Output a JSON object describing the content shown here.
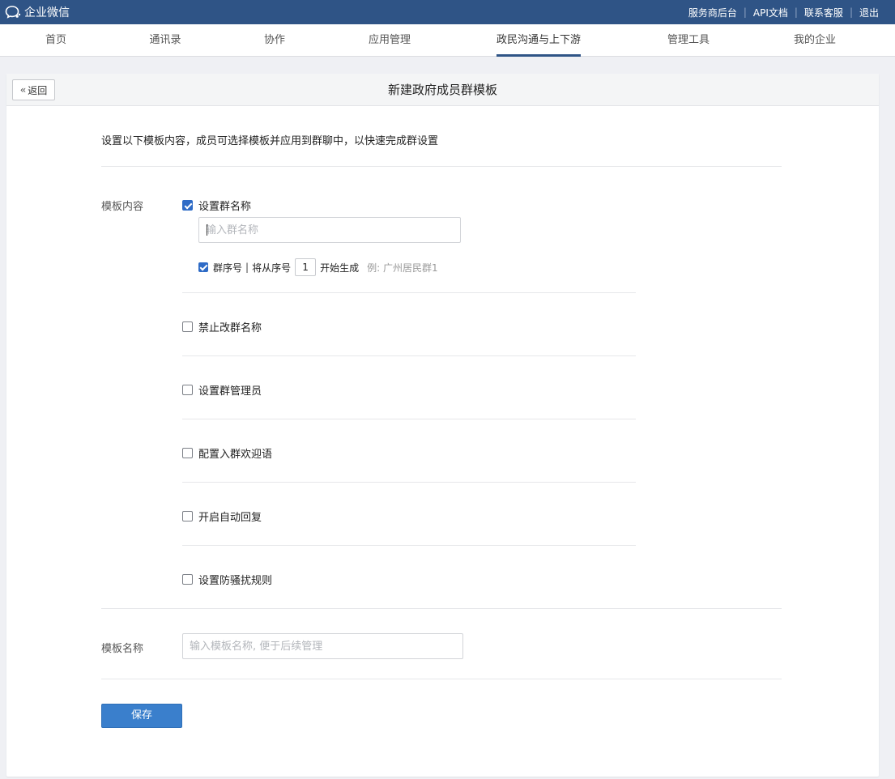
{
  "app": {
    "name": "企业微信"
  },
  "toplinks": [
    "服务商后台",
    "API文档",
    "联系客服",
    "退出"
  ],
  "nav": {
    "items": [
      "首页",
      "通讯录",
      "协作",
      "应用管理",
      "政民沟通与上下游",
      "管理工具",
      "我的企业"
    ],
    "active_index": 4
  },
  "page": {
    "back_label": "返回",
    "title": "新建政府成员群模板",
    "description": "设置以下模板内容，成员可选择模板并应用到群聊中，以快速完成群设置"
  },
  "template_content": {
    "label": "模板内容",
    "options": [
      {
        "label": "设置群名称",
        "checked": true
      },
      {
        "label": "禁止改群名称",
        "checked": false
      },
      {
        "label": "设置群管理员",
        "checked": false
      },
      {
        "label": "配置入群欢迎语",
        "checked": false
      },
      {
        "label": "开启自动回复",
        "checked": false
      },
      {
        "label": "设置防骚扰规则",
        "checked": false
      }
    ],
    "group_name_placeholder": "输入群名称",
    "sequence": {
      "label": "群序号",
      "checked": true,
      "prefix": "将从序号",
      "start_value": "1",
      "suffix": "开始生成",
      "example": "例: 广州居民群1"
    }
  },
  "template_name": {
    "label": "模板名称",
    "placeholder": "输入模板名称, 便于后续管理"
  },
  "save_label": "保存",
  "colors": {
    "topbar": "#2f5486",
    "primary": "#3a7fcc",
    "checkbox_checked": "#2e6bc6"
  }
}
